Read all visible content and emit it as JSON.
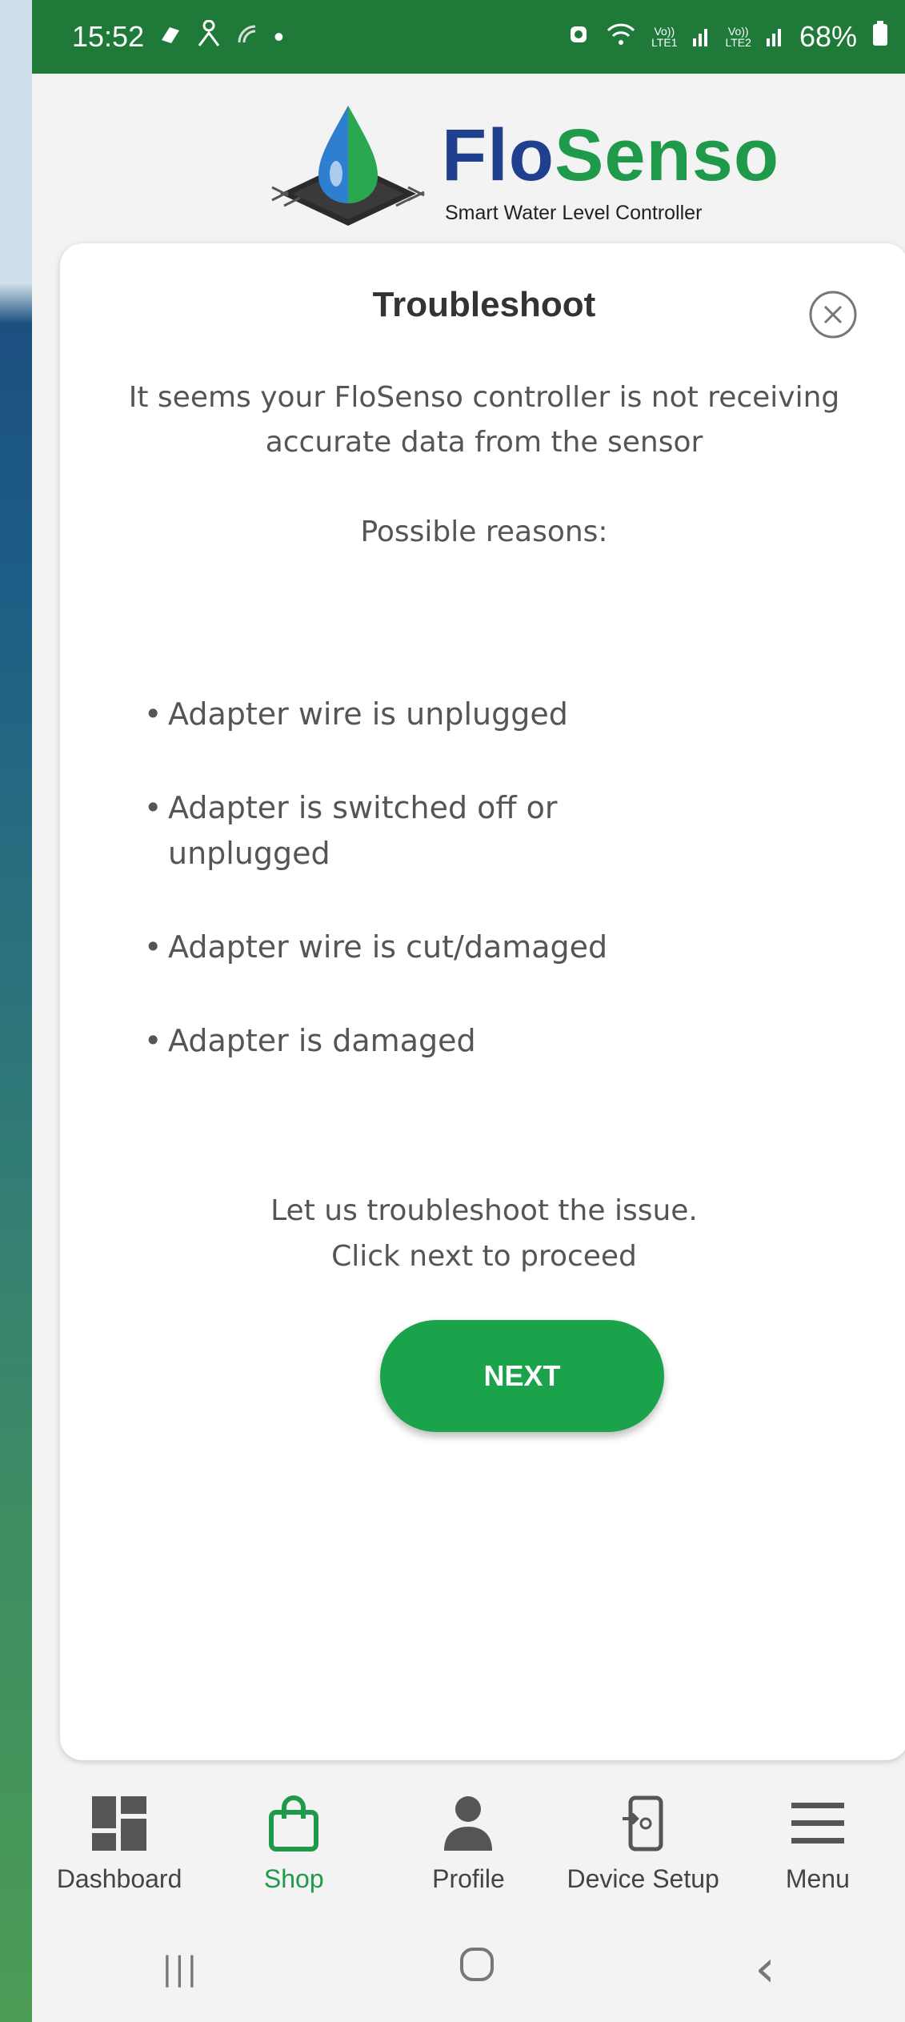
{
  "status_bar": {
    "time": "15:52",
    "battery": "68%",
    "left_icons": [
      "app-notification-icon",
      "person-icon",
      "signal-icon",
      "dot-icon"
    ],
    "right_icons": [
      "alarm-icon",
      "wifi-icon",
      "volte-lte1-signal-icon",
      "volte-lte2-signal-icon",
      "battery-icon"
    ],
    "lte1": "LTE1",
    "lte2": "LTE2",
    "volte": "Vo))"
  },
  "logo": {
    "title_part1": "Flo",
    "title_part2": "Senso",
    "subtitle": "Smart Water Level Controller"
  },
  "dialog": {
    "title": "Troubleshoot",
    "intro": "It seems your FloSenso controller is not receiving accurate data from the sensor",
    "reasons_title": "Possible reasons:",
    "reasons": [
      "Adapter wire is unplugged",
      "Adapter is switched off or unplugged",
      "Adapter wire is cut/damaged",
      "Adapter is damaged"
    ],
    "cta": "Let us troubleshoot the issue. Click next to proceed",
    "next_label": "NEXT"
  },
  "bottom_nav": {
    "items": [
      {
        "label": "Dashboard",
        "icon": "dashboard-icon",
        "active": false
      },
      {
        "label": "Shop",
        "icon": "shopping-bag-icon",
        "active": true
      },
      {
        "label": "Profile",
        "icon": "profile-icon",
        "active": false
      },
      {
        "label": "Device Setup",
        "icon": "device-setup-icon",
        "active": false
      },
      {
        "label": "Menu",
        "icon": "menu-icon",
        "active": false
      }
    ]
  },
  "system_nav": {
    "recents": "|||",
    "home": "○",
    "back": "‹"
  },
  "colors": {
    "brand_green": "#1f9a4b",
    "brand_blue": "#1f3f8f",
    "status_bar": "#1f7a3a",
    "button_green": "#1aa34a"
  }
}
